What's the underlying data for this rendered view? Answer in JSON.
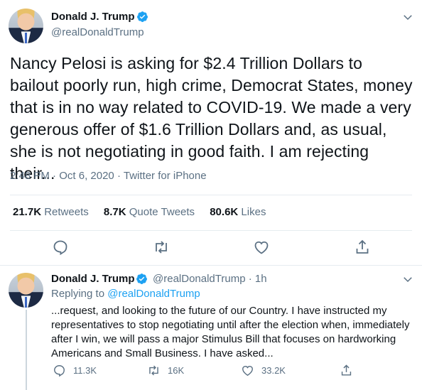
{
  "main_tweet": {
    "author_name": "Donald J. Trump",
    "author_handle": "@realDonaldTrump",
    "text": "Nancy Pelosi is asking for $2.4 Trillion Dollars to bailout poorly run, high crime, Democrat States, money that is in no way related to COVID-19. We made a very generous offer of $1.6 Trillion Dollars and, as usual, she is not negotiating in good faith. I am rejecting their...",
    "time": "2:48 PM",
    "date": "Oct 6, 2020",
    "source": "Twitter for iPhone",
    "separator": "·",
    "stats": {
      "retweets_count": "21.7K",
      "retweets_label": "Retweets",
      "quote_count": "8.7K",
      "quote_label": "Quote Tweets",
      "likes_count": "80.6K",
      "likes_label": "Likes"
    }
  },
  "reply_tweet": {
    "author_name": "Donald J. Trump",
    "author_handle": "@realDonaldTrump",
    "separator": "·",
    "time_ago": "1h",
    "replying_to_label": "Replying to",
    "replying_to_handle": "@realDonaldTrump",
    "text": "...request, and looking to the future of our Country. I have instructed my representatives to stop negotiating until after the election when, immediately after I win, we will pass a major Stimulus Bill that focuses on hardworking Americans and Small Business. I have asked...",
    "reply_count": "11.3K",
    "retweet_count": "16K",
    "like_count": "33.2K"
  },
  "icons": {
    "verified": "verified-badge-icon",
    "more": "chevron-down-icon",
    "reply": "reply-icon",
    "retweet": "retweet-icon",
    "like": "heart-icon",
    "share": "share-icon"
  },
  "colors": {
    "brand_blue": "#1da1f2",
    "text_primary": "#0f1419",
    "text_secondary": "#5b7083",
    "divider": "#e6ecf0"
  }
}
